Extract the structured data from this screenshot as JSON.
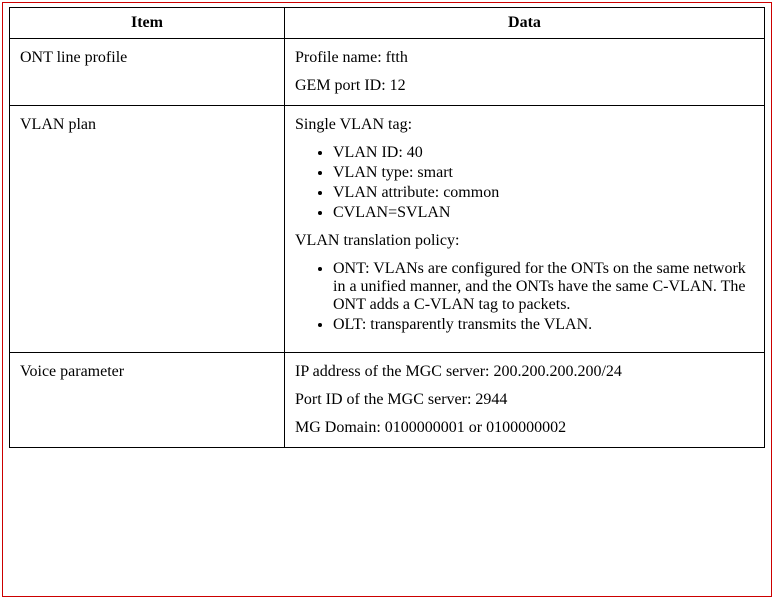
{
  "headers": {
    "item": "Item",
    "data": "Data"
  },
  "rows": [
    {
      "item": "ONT line profile",
      "data": {
        "p1": "Profile name: ftth",
        "p2": "GEM port ID: 12"
      }
    },
    {
      "item": "VLAN plan",
      "data": {
        "p1": "Single VLAN tag:",
        "li1": "VLAN ID: 40",
        "li2": "VLAN type: smart",
        "li3": "VLAN attribute: common",
        "li4": "CVLAN=SVLAN",
        "p2": "VLAN translation policy:",
        "li5": "ONT: VLANs are configured for the ONTs on the same network in a unified manner, and the ONTs have the same C-VLAN. The ONT adds a C-VLAN tag to packets.",
        "li6": "OLT: transparently transmits the VLAN.",
        "spacer": " "
      }
    },
    {
      "item": "Voice parameter",
      "data": {
        "p1": "IP address of the MGC server: 200.200.200.200/24",
        "p2": "Port ID of the MGC server: 2944",
        "p3": "MG Domain: 0100000001 or 0100000002"
      }
    }
  ]
}
